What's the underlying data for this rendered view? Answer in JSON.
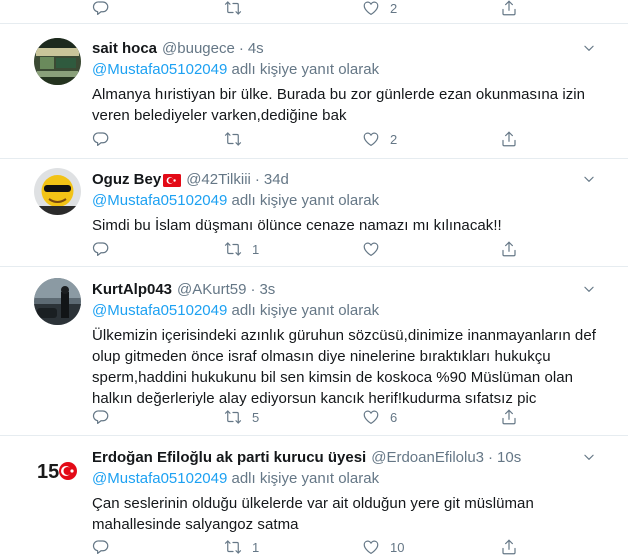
{
  "top_actions": {
    "like_count": "2"
  },
  "tweets": [
    {
      "name": "sait hoca",
      "handle": "@buugece",
      "time": "4s",
      "reply_prefix": "@Mustafa05102049",
      "reply_suffix": " adlı kişiye yanıt olarak",
      "text": "Almanya hıristiyan bir ülke. Burada bu zor günlerde ezan okunmasına izin veren belediyeler varken,dediğine bak",
      "retweets": "",
      "likes": "2"
    },
    {
      "name": "Oguz Bey",
      "handle": "@42Tilkiii",
      "time": "34d",
      "reply_prefix": "@Mustafa05102049",
      "reply_suffix": " adlı kişiye yanıt olarak",
      "text": "Simdi bu İslam düşmanı ölünce cenaze namazı mı kılınacak!!",
      "retweets": "1",
      "likes": ""
    },
    {
      "name": "KurtAlp043",
      "handle": "@AKurt59",
      "time": "3s",
      "reply_prefix": "@Mustafa05102049",
      "reply_suffix": " adlı kişiye yanıt olarak",
      "text": "Ülkemizin içerisindeki azınlık güruhun sözcüsü,dinimize inanmayanların def olup gitmeden önce israf olmasın diye ninelerine bıraktıkları hukukçu sperm,haddini hukukunu bil sen kimsin de koskoca %90 Müslüman olan halkın değerleriyle alay ediyorsun kancık herif!kudurma sıfatsız pic",
      "retweets": "5",
      "likes": "6"
    },
    {
      "name": "Erdoğan Efiloğlu ak parti kurucu üyesi",
      "handle": "@ErdoanEfilolu3",
      "time": "10s",
      "reply_prefix": "@Mustafa05102049",
      "reply_suffix": " adlı kişiye yanıt olarak",
      "text": "Çan seslerinin olduğu ülkelerde var ait olduğun yere git müslüman mahallesinde salyangoz satma",
      "retweets": "1",
      "likes": "10"
    }
  ],
  "avatar4_text": "150",
  "colors": {
    "accent": "#1da1f2",
    "muted": "#657786",
    "border": "#e6ecf0",
    "text": "#14171a"
  }
}
